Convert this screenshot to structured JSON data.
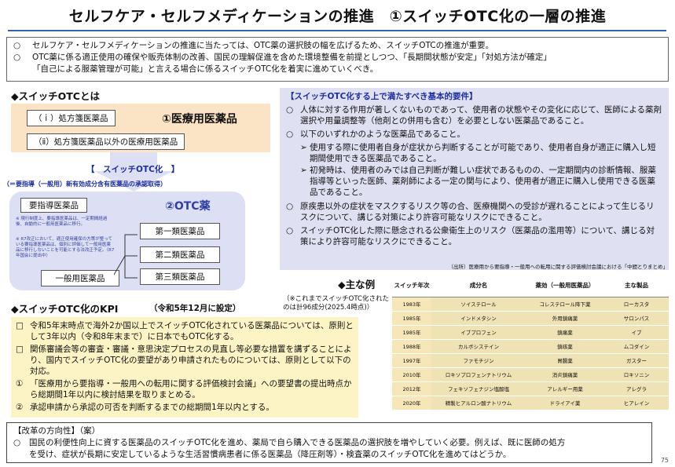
{
  "title": "セルフケア・セルフメディケーションの推進　①スイッチOTC化の一層の推進",
  "intro": {
    "bullet": "○",
    "line1": "セルフケア・セルフメディケーションの推進に当たっては、OTC薬の選択肢の幅を広げるため、スイッチOTCの推進が重要。",
    "line2a": "OTC薬に係る適正使用の確保や販売体制の改善、国民の理解促進を含めた環境整備を前提としつつ、「長期間状態が安定」「対処方法が確定」",
    "line2b": "「自己による服薬管理が可能」と言える場合に係るスイッチOTC化を着実に進めていくべき。"
  },
  "left": {
    "heading": "◆スイッチOTCとは",
    "pill1": "（ｉ）処方箋医薬品",
    "pill2": "（ⅱ）処方箋医薬品以外の医療用医薬品",
    "med_label": "①医療用医薬品",
    "arrow_label": "【　スイッチOTC化　】",
    "arrow_sub": "（＝要指導（一般用）新有効成分含有医薬品の承認取得）",
    "otc_label": "②OTC薬",
    "yoshido": "要指導医薬品",
    "note1": "※ 現行制度上、要指導医薬品は、一定期間経過後、自動的に一般用医薬品に移行。",
    "note2": "※ R7改正において、適正使用確保の方策が整っている要指導医薬品は、個別に評価して一般用医薬品に移行しないことを可能とする法改正予定。（R7年国会に提出中）",
    "class1": "第一類医薬品",
    "class2": "第二類医薬品",
    "class3": "第三類医薬品",
    "ippan": "一般用医薬品"
  },
  "requirements": {
    "heading": "【スイッチOTC化する上で満たすべき基本的要件】",
    "r1": "人体に対する作用が著しくないものであって、使用者の状態やその変化に応じて、医師による薬剤選択や用量調整等（他剤との併用も含む）を必要としない医薬品であること。",
    "r2": "以下のいずれかのような医薬品であること。",
    "r2a": "使用する際に使用者自身が症状から判断することが可能であり、使用者自身が適正に購入し短期間使用できる医薬品であること。",
    "r2b": "初発時は、使用者のみでは自己判断が難しい症状であるものの、一定期間内の診断情報、服薬指導等といった医師、薬剤師による一定の関与により、使用者が適正に購入し使用できる医薬品であること。",
    "r3": "原疾患以外の症状をマスクするリスク等の合、医療機関への受診が遅れることによって生じるリスクについて、講じる対策により許容可能なリスクにできること。",
    "r4": "スイッチOTC化した際に懸念される公衆衛生上のリスク（医薬品の濫用等）について、講じる対策により許容可能なリスクにできること。",
    "source": "（出所）医療用から要指導・一般用への転用に関する評価検討会議における「中間とりまとめ」"
  },
  "kpi": {
    "heading": "◆スイッチOTC化のKPI",
    "heading_note": "（令和5年12月に設定）",
    "k1": "令和5年末時点で海外2か国以上でスイッチOTC化されている医薬品については、原則として3年以内（令和8年末まで）に日本でもOTC化する。",
    "k2": "関係審議会等の審査・審議・意思決定プロセスの見直し等必要な措置を講ずることにより、国内でスイッチOTC化の要望があり申請されたものについては、原則として以下の対応。",
    "k3": "「医療用から要指導・一般用への転用に関する評価検討会議」への要望書の提出時点から総期間1年以内に検討結果を取りまとめる。",
    "k4": "承認申請から承認の可否を判断するまでの総期間1年以内とする。"
  },
  "examples": {
    "heading": "◆主な例",
    "note": "（※これまでスイッチOTC化されたのは計96成分(2025.4時点)）",
    "headers": [
      "スイッチ年次",
      "成分名",
      "薬効（一般用医薬品）",
      "主な製品"
    ],
    "rows": [
      [
        "1983年",
        "ソイステロール",
        "コレステロール降下薬",
        "ローカスタ"
      ],
      [
        "1985年",
        "インドメタシン",
        "外用鎮痛薬",
        "サロンパス"
      ],
      [
        "1985年",
        "イブプロフェン",
        "鎮痛薬",
        "イブ"
      ],
      [
        "1988年",
        "カルボシステイン",
        "鎮咳薬",
        "ムコダイン"
      ],
      [
        "1997年",
        "ファモチジン",
        "胃腸薬",
        "ガスター"
      ],
      [
        "2010年",
        "ロキソプロフェンナトリウム",
        "消炎鎮痛薬",
        "ロキソニン"
      ],
      [
        "2012年",
        "フェキソフェナジン塩酸塩",
        "アレルギー用薬",
        "アレグラ"
      ],
      [
        "2020年",
        "精製ヒアルロン酸ナトリウム",
        "ドライアイ薬",
        "ヒアレイン"
      ]
    ]
  },
  "reform": {
    "heading": "【改革の方向性】（案）",
    "line1": "国民の利便性向上に資する医薬品のスイッチOTC化を進め、薬局で自ら購入できる医薬品の選択肢を増やしていく必要。例えば、既に医師の処方",
    "line2": "を受け、症状が長期に安定しているような生活習慣病患者に係る医薬品（降圧剤等）・検査薬のスイッチOTC化を進めてはどうか。"
  },
  "page_number": "75"
}
